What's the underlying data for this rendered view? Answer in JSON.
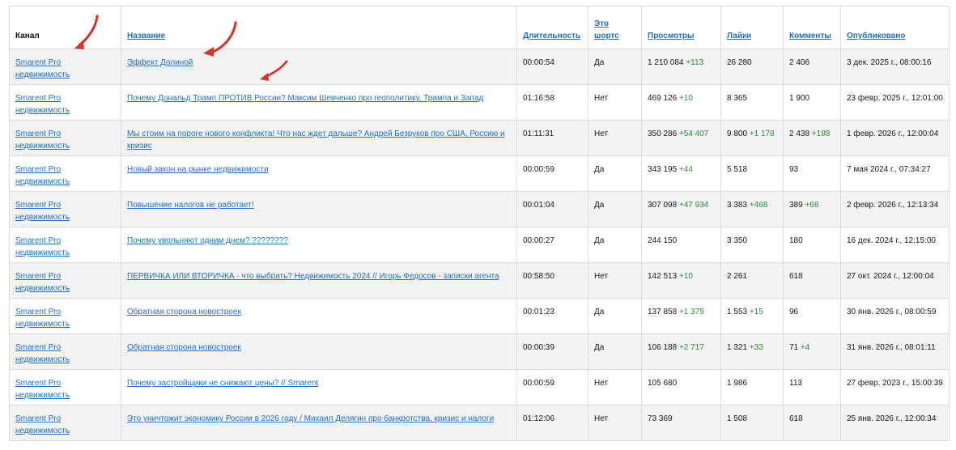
{
  "table": {
    "headers": {
      "channel": "Канал",
      "title": "Название",
      "duration": "Длительность",
      "shorts": "Это шортс",
      "views": "Просмотры",
      "likes": "Лайки",
      "comments": "Комменты",
      "published": "Опубликовано"
    },
    "rows": [
      {
        "channel": "Smarent Pro недвижимость",
        "title": "Эффект Долиной",
        "duration": "00:00:54",
        "shorts": "Да",
        "views": "1 210 084",
        "views_delta": "+113",
        "likes": "26 280",
        "likes_delta": "",
        "comments": "2 406",
        "comments_delta": "",
        "published": "3 дек. 2025 г., 08:00:16"
      },
      {
        "channel": "Smarent Pro недвижимость",
        "title": "Почему Дональд Трамп ПРОТИВ России? Максим Шевченко про геополитику, Трампа и Запад",
        "duration": "01:16:58",
        "shorts": "Нет",
        "views": "469 126",
        "views_delta": "+10",
        "likes": "8 365",
        "likes_delta": "",
        "comments": "1 900",
        "comments_delta": "",
        "published": "23 февр. 2025 г., 12:01:00"
      },
      {
        "channel": "Smarent Pro недвижимость",
        "title": "Мы стоим на пороге нового конфликта! Что нас ждет дальше? Андрей Безруков про США, Россию и кризис",
        "duration": "01:11:31",
        "shorts": "Нет",
        "views": "350 286",
        "views_delta": "+54 407",
        "likes": "9 800",
        "likes_delta": "+1 178",
        "comments": "2 438",
        "comments_delta": "+188",
        "published": "1 февр. 2026 г., 12:00:04"
      },
      {
        "channel": "Smarent Pro недвижимость",
        "title": "Новый закон на рынке недвижимости",
        "duration": "00:00:59",
        "shorts": "Да",
        "views": "343 195",
        "views_delta": "+44",
        "likes": "5 518",
        "likes_delta": "",
        "comments": "93",
        "comments_delta": "",
        "published": "7 мая 2024 г., 07:34:27"
      },
      {
        "channel": "Smarent Pro недвижимость",
        "title": "Повышение налогов не работает!",
        "duration": "00:01:04",
        "shorts": "Да",
        "views": "307 098",
        "views_delta": "+47 934",
        "likes": "3 383",
        "likes_delta": "+468",
        "comments": "389",
        "comments_delta": "+68",
        "published": "2 февр. 2026 г., 12:13:34"
      },
      {
        "channel": "Smarent Pro недвижимость",
        "title": "Почему увольняют одним днем? ????????",
        "duration": "00:00:27",
        "shorts": "Да",
        "views": "244 150",
        "views_delta": "",
        "likes": "3 350",
        "likes_delta": "",
        "comments": "180",
        "comments_delta": "",
        "published": "16 дек. 2024 г., 12:15:00"
      },
      {
        "channel": "Smarent Pro недвижимость",
        "title": "ПЕРВИЧКА ИЛИ ВТОРИЧКА - что выбрать? Недвижимость 2024 // Игорь Федосов - записки агента",
        "duration": "00:58:50",
        "shorts": "Нет",
        "views": "142 513",
        "views_delta": "+10",
        "likes": "2 261",
        "likes_delta": "",
        "comments": "618",
        "comments_delta": "",
        "published": "27 окт. 2024 г., 12:00:04"
      },
      {
        "channel": "Smarent Pro недвижимость",
        "title": "Обратная сторона новостроек",
        "duration": "00:01:23",
        "shorts": "Да",
        "views": "137 858",
        "views_delta": "+1 375",
        "likes": "1 553",
        "likes_delta": "+15",
        "comments": "96",
        "comments_delta": "",
        "published": "30 янв. 2026 г., 08:00:59"
      },
      {
        "channel": "Smarent Pro недвижимость",
        "title": "Обратная сторона новостроек",
        "duration": "00:00:39",
        "shorts": "Да",
        "views": "106 188",
        "views_delta": "+2 717",
        "likes": "1 321",
        "likes_delta": "+33",
        "comments": "71",
        "comments_delta": "+4",
        "published": "31 янв. 2026 г., 08:01:11"
      },
      {
        "channel": "Smarent Pro недвижимость",
        "title": "Почему застройщики не снижают цены? // Smarent",
        "duration": "00:00:59",
        "shorts": "Нет",
        "views": "105 680",
        "views_delta": "",
        "likes": "1 986",
        "likes_delta": "",
        "comments": "113",
        "comments_delta": "",
        "published": "27 февр. 2023 г., 15:00:39"
      },
      {
        "channel": "Smarent Pro недвижимость",
        "title": "Это уничтожит экономику России в 2026 году / Михаил Делягин про банкротства, кризис и налоги",
        "duration": "01:12:06",
        "shorts": "Нет",
        "views": "73 369",
        "views_delta": "",
        "likes": "1 508",
        "likes_delta": "",
        "comments": "618",
        "comments_delta": "",
        "published": "25 янв. 2026 г., 12:00:34"
      }
    ]
  },
  "colors": {
    "link": "#1f6fc8",
    "delta_positive": "#2e8b3a",
    "annotation_arrow": "#d9342b",
    "row_alt": "#f2f2f2",
    "border": "#dcdcdc"
  },
  "annotations": [
    {
      "icon": "red-dotted-arrow-icon",
      "points_to": "channel column"
    },
    {
      "icon": "red-dotted-arrow-icon",
      "points_to": "first title link"
    },
    {
      "icon": "red-dotted-arrow-icon",
      "points_to": "second title link"
    }
  ]
}
